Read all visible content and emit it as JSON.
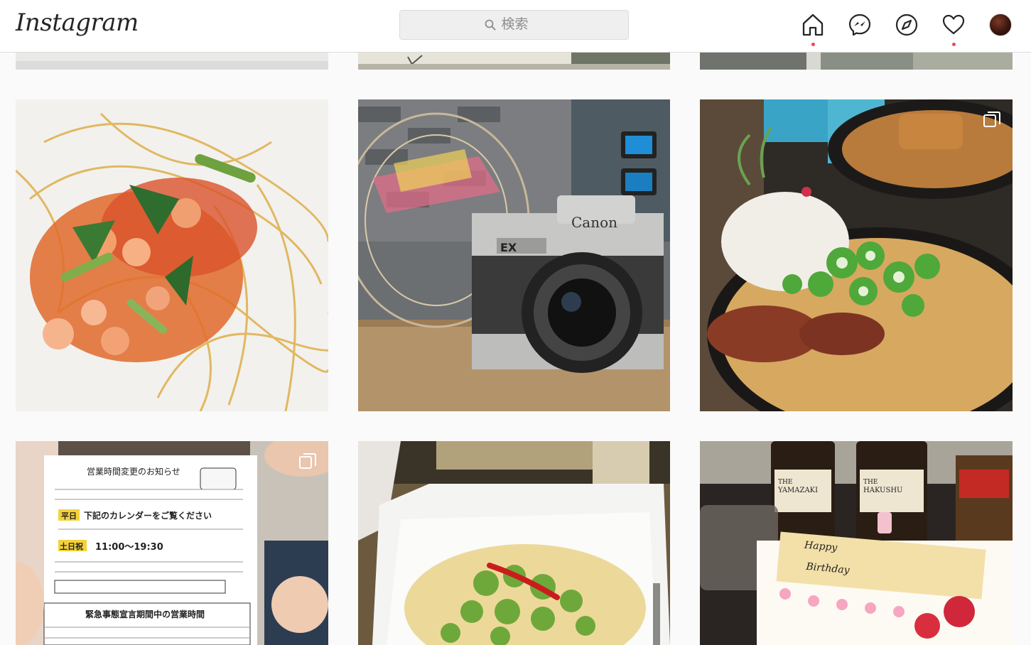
{
  "header": {
    "logo_text": "Instagram",
    "search": {
      "placeholder": "検索"
    },
    "nav": [
      {
        "name": "home",
        "icon": "home-icon",
        "notification_dot": true
      },
      {
        "name": "direct",
        "icon": "messenger-icon",
        "notification_dot": false
      },
      {
        "name": "explore",
        "icon": "compass-icon",
        "notification_dot": false
      },
      {
        "name": "activity",
        "icon": "heart-icon",
        "notification_dot": true
      },
      {
        "name": "profile",
        "icon": "avatar",
        "notification_dot": false
      }
    ]
  },
  "colors": {
    "notification": "#ed4956",
    "text_primary": "#262626",
    "text_secondary": "#8e8e8e",
    "border": "#dbdbdb",
    "background": "#fafafa"
  },
  "posts": [
    {
      "subject": "top partial row - left",
      "multi_image": false
    },
    {
      "subject": "top partial row - center",
      "multi_image": false
    },
    {
      "subject": "top partial row - right",
      "multi_image": false
    },
    {
      "subject": "shrimp tomato pasta",
      "multi_image": false
    },
    {
      "subject": "vintage film camera with basket",
      "multi_image": false
    },
    {
      "subject": "curry rice with green onions",
      "multi_image": true
    },
    {
      "subject": "person holding business hours notice",
      "multi_image": true,
      "sign_title": "営業時間変更のお知らせ",
      "sign_lines": [
        "平日 下記のカレンダーをご覧ください",
        "土日祝 11:00〜19:30"
      ],
      "sign_footer": "緊急事態宣言期間中の営業時間"
    },
    {
      "subject": "broccoli pasta with chili and champagne",
      "multi_image": false
    },
    {
      "subject": "birthday cake with whisky bottles",
      "multi_image": false,
      "cake_text": "Happy Birthday"
    }
  ]
}
